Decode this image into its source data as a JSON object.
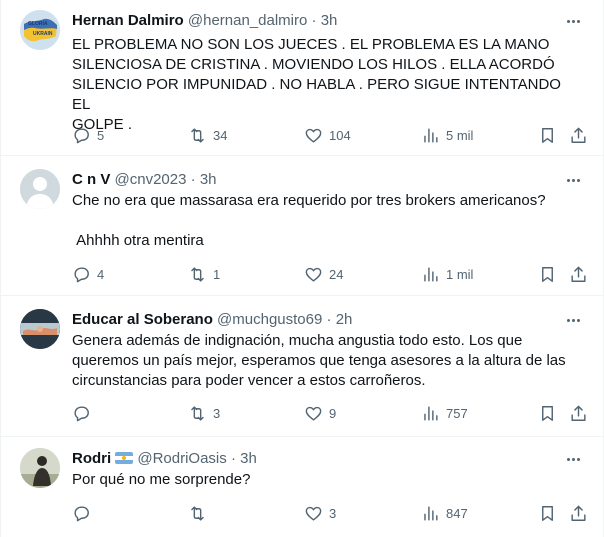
{
  "tweets": [
    {
      "name": "Hernan Dalmiro",
      "handle": "@hernan_dalmiro",
      "time": "3h",
      "text": "EL PROBLEMA NO SON LOS JUECES . EL PROBLEMA ES LA MANO\nSILENCIOSA DE CRISTINA . MOVIENDO LOS HILOS . ELLA ACORDÓ\nSILENCIO POR IMPUNIDAD . NO HABLA . PERO SIGUE INTENTANDO EL\nGOLPE .",
      "avatar_text": "GLORIA\nUKRAIN",
      "replies": "5",
      "reposts": "34",
      "likes": "104",
      "views": "5 mil"
    },
    {
      "name": "C n V",
      "handle": "@cnv2023",
      "time": "3h",
      "text": "Che no era que massarasa era requerido por tres brokers americanos?\n\n Ahhhh otra mentira",
      "replies": "4",
      "reposts": "1",
      "likes": "24",
      "views": "1 mil"
    },
    {
      "name": "Educar al Soberano",
      "handle": "@muchgusto69",
      "time": "2h",
      "text": "Genera además de indignación, mucha angustia todo esto. Los que\nqueremos un país mejor, esperamos que tenga asesores a la altura de las\ncircunstancias para poder vencer a estos carroñeros.",
      "replies": "",
      "reposts": "3",
      "likes": "9",
      "views": "757"
    },
    {
      "name": "Rodri",
      "handle": "@RodriOasis",
      "time": "3h",
      "text": "Por qué no me sorprende?",
      "replies": "",
      "reposts": "",
      "likes": "3",
      "views": "847"
    }
  ],
  "separator": "·",
  "icons": {
    "reply": "reply-icon",
    "repost": "repost-icon",
    "like": "heart-icon",
    "views": "views-icon",
    "bookmark": "bookmark-icon",
    "share": "share-icon",
    "more": "more-icon",
    "flag": "argentina-flag-icon"
  },
  "colors": {
    "text": "#0f1419",
    "secondary": "#536471",
    "border": "#eff3f4"
  }
}
